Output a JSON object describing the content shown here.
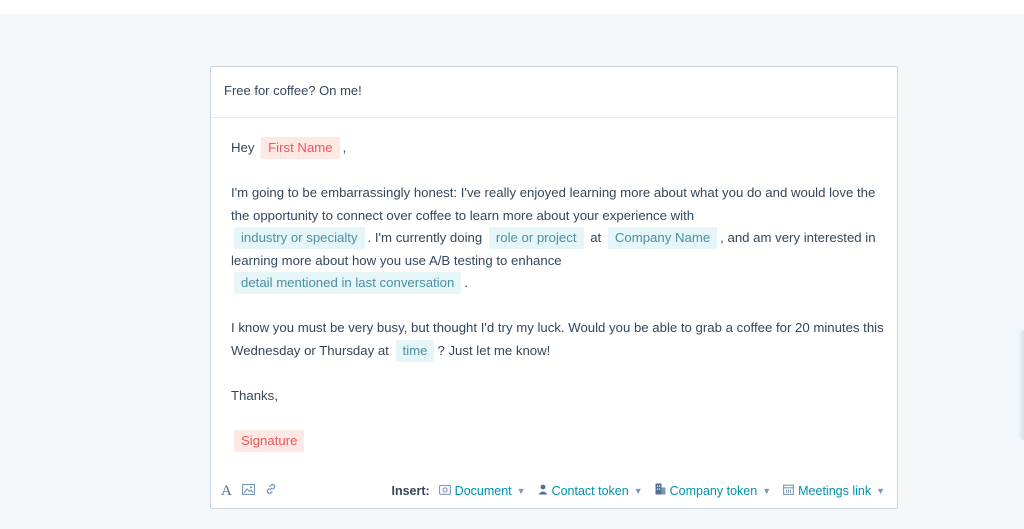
{
  "email": {
    "subject": "Free for coffee? On me!",
    "greeting": "Hey",
    "greeting_punct": ",",
    "tokens": {
      "first_name": "First Name",
      "industry": "industry or specialty",
      "role": "role or project",
      "company": "Company Name",
      "detail": "detail mentioned in last conversation",
      "time": "time",
      "signature": "Signature"
    },
    "para1_a": "I'm going to be embarrassingly honest: I've really enjoyed learning more about what you do and would love the the opportunity to connect over coffee to learn more about your experience with",
    "para1_b": ". I'm currently doing",
    "para1_c": "at",
    "para1_d": ", and am very interested in learning more about how you use A/B testing to enhance",
    "para1_e": ".",
    "para2_a": "I know you must be very busy, but thought I'd try my luck. Would you be able to grab a coffee for 20 minutes this Wednesday or Thursday at",
    "para2_b": "? Just let me know!",
    "closing": "Thanks,"
  },
  "toolbar": {
    "icons": [
      "font-icon",
      "image-icon",
      "link-icon"
    ],
    "insert_label": "Insert:",
    "document": "Document",
    "contact_token": "Contact token",
    "company_token": "Company token",
    "meetings_link": "Meetings link"
  },
  "colors": {
    "contact_token_bg": "#fde8e4",
    "contact_token_text": "#f2545b",
    "custom_token_bg": "#e5f5f8",
    "custom_token_text": "#4a90a4",
    "link": "#0091ae"
  }
}
